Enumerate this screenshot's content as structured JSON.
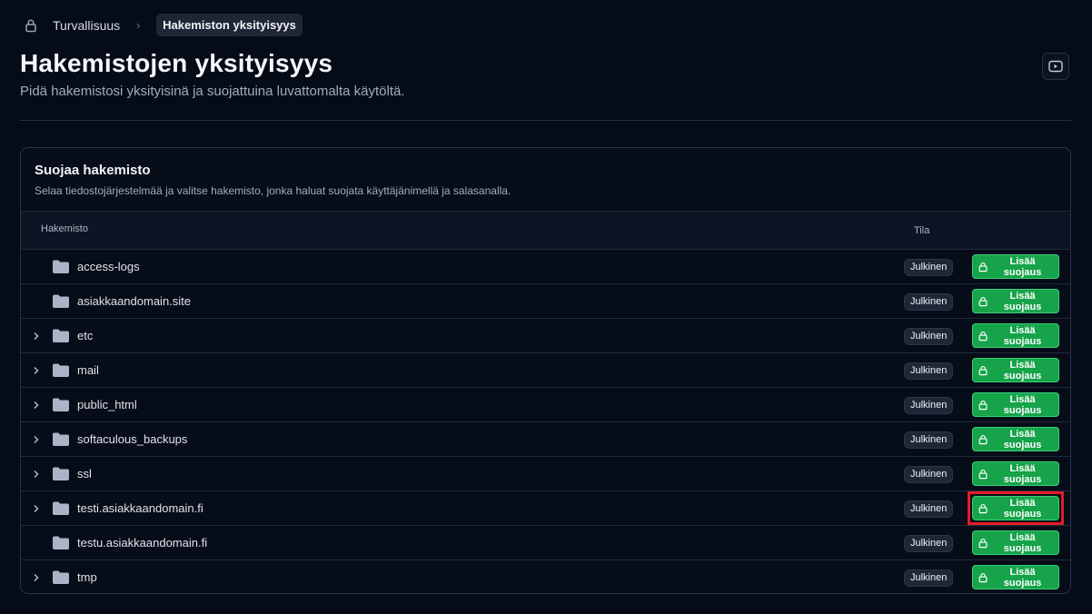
{
  "breadcrumb": {
    "icon": "lock-icon",
    "parent": "Turvallisuus",
    "current": "Hakemiston yksityisyys"
  },
  "page": {
    "title": "Hakemistojen yksityisyys",
    "subtitle": "Pidä hakemistosi yksityisinä ja suojattuina luvattomalta käytöltä.",
    "video_icon": "video-play-icon"
  },
  "card": {
    "title": "Suojaa hakemisto",
    "description": "Selaa tiedostojärjestelmää ja valitse hakemisto, jonka haluat suojata käyttäjänimellä ja salasanalla.",
    "columns": {
      "directory": "Hakemisto",
      "state": "Tila"
    },
    "button_label": "Lisää suojaus",
    "rows": [
      {
        "name": "access-logs",
        "state": "Julkinen",
        "expandable": false,
        "highlighted": false
      },
      {
        "name": "asiakkaandomain.site",
        "state": "Julkinen",
        "expandable": false,
        "highlighted": false
      },
      {
        "name": "etc",
        "state": "Julkinen",
        "expandable": true,
        "highlighted": false
      },
      {
        "name": "mail",
        "state": "Julkinen",
        "expandable": true,
        "highlighted": false
      },
      {
        "name": "public_html",
        "state": "Julkinen",
        "expandable": true,
        "highlighted": false
      },
      {
        "name": "softaculous_backups",
        "state": "Julkinen",
        "expandable": true,
        "highlighted": false
      },
      {
        "name": "ssl",
        "state": "Julkinen",
        "expandable": true,
        "highlighted": false
      },
      {
        "name": "testi.asiakkaandomain.fi",
        "state": "Julkinen",
        "expandable": true,
        "highlighted": true
      },
      {
        "name": "testu.asiakkaandomain.fi",
        "state": "Julkinen",
        "expandable": false,
        "highlighted": false
      },
      {
        "name": "tmp",
        "state": "Julkinen",
        "expandable": true,
        "highlighted": false
      }
    ]
  },
  "colors": {
    "background": "#050b17",
    "accent_green": "#16a34a",
    "highlight_red": "#e11d26",
    "badge_bg": "#1f2737"
  }
}
